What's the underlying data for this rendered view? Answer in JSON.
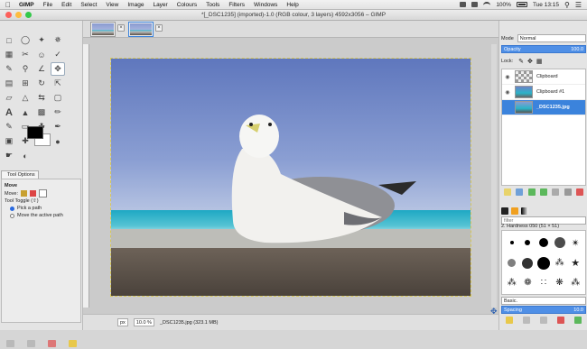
{
  "menubar": {
    "app": "GIMP",
    "items": [
      "File",
      "Edit",
      "Select",
      "View",
      "Image",
      "Layer",
      "Colours",
      "Tools",
      "Filters",
      "Windows",
      "Help"
    ],
    "battery": "100%",
    "time": "Tue 13:15"
  },
  "window": {
    "title": "*[_DSC1235] (imported)-1.0 (RGB colour, 3 layers) 4592x3056 – GIMP"
  },
  "tool_options": {
    "tab_label": "Tool Options",
    "section": "Move",
    "move_label": "Move:",
    "toggle_label": "Tool Toggle  (⇧)",
    "options": [
      "Pick a path",
      "Move the active path"
    ],
    "selected_option": 0
  },
  "tools": [
    "rect-select",
    "ellipse-select",
    "free-select",
    "fuzzy-select",
    "color-select",
    "scissors",
    "foreground-select",
    "paths",
    "color-picker",
    "zoom",
    "measure",
    "move",
    "align",
    "crop",
    "rotate",
    "scale",
    "shear",
    "perspective",
    "flip",
    "cage",
    "text",
    "bucket-fill",
    "blend",
    "pencil",
    "paintbrush",
    "eraser",
    "airbrush",
    "ink",
    "clone",
    "heal",
    "perspective-clone",
    "blur",
    "smudge",
    "dodge"
  ],
  "active_tool": "move",
  "colors": {
    "foreground": "#000000",
    "background": "#ffffff",
    "accent": "#3b83dc"
  },
  "status": {
    "unit": "px",
    "zoom": "10.0 %",
    "info": "_DSC1235.jpg (323.1 MB)"
  },
  "layers_dock": {
    "mode_label": "Mode",
    "mode_value": "Normal",
    "opacity_label": "Opacity",
    "opacity_value": "100.0",
    "lock_label": "Lock:",
    "layers": [
      {
        "name": "Clipboard",
        "visible": true,
        "active": false
      },
      {
        "name": "Clipboard #1",
        "visible": true,
        "active": false
      },
      {
        "name": "_DSC1235.jpg",
        "visible": false,
        "active": true
      }
    ]
  },
  "brushes_dock": {
    "filter_placeholder": "filter",
    "brush_name": "2. Hardness 050 (51 × 51)",
    "basic_label": "Basic.",
    "spacing_label": "Spacing",
    "spacing_value": "10.0"
  }
}
